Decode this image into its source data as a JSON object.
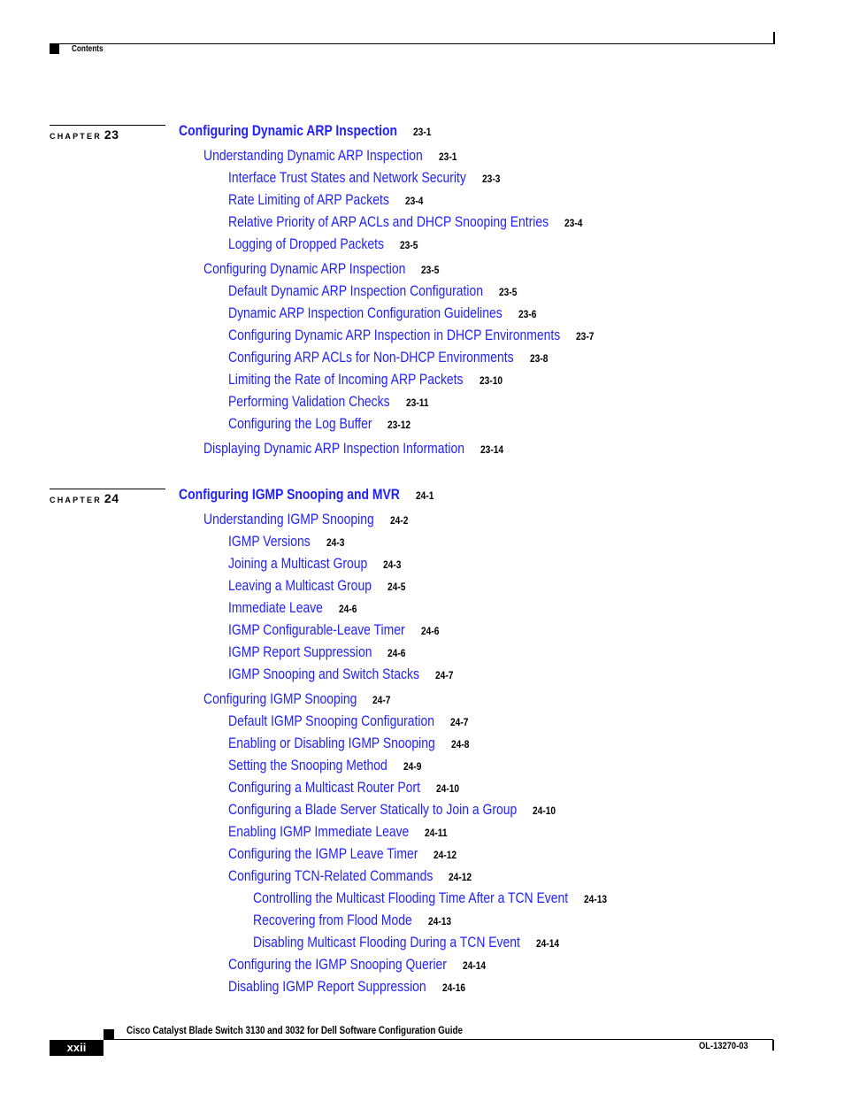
{
  "header": {
    "section_label": "Contents"
  },
  "chapters": [
    {
      "chapter_word": "CHAPTER",
      "number": "23",
      "title": "Configuring Dynamic ARP Inspection",
      "page": "23-1",
      "entries": [
        {
          "level": 1,
          "title": "Understanding Dynamic ARP Inspection",
          "page": "23-1"
        },
        {
          "level": 2,
          "title": "Interface Trust States and Network Security",
          "page": "23-3"
        },
        {
          "level": 2,
          "title": "Rate Limiting of ARP Packets",
          "page": "23-4"
        },
        {
          "level": 2,
          "title": "Relative Priority of ARP ACLs and DHCP Snooping Entries",
          "page": "23-4"
        },
        {
          "level": 2,
          "title": "Logging of Dropped Packets",
          "page": "23-5"
        },
        {
          "level": 1,
          "title": "Configuring Dynamic ARP Inspection",
          "page": "23-5"
        },
        {
          "level": 2,
          "title": "Default Dynamic ARP Inspection Configuration",
          "page": "23-5"
        },
        {
          "level": 2,
          "title": "Dynamic ARP Inspection Configuration Guidelines",
          "page": "23-6"
        },
        {
          "level": 2,
          "title": "Configuring Dynamic ARP Inspection in DHCP Environments",
          "page": "23-7"
        },
        {
          "level": 2,
          "title": "Configuring ARP ACLs for Non-DHCP Environments",
          "page": "23-8"
        },
        {
          "level": 2,
          "title": "Limiting the Rate of Incoming ARP Packets",
          "page": "23-10"
        },
        {
          "level": 2,
          "title": "Performing Validation Checks",
          "page": "23-11"
        },
        {
          "level": 2,
          "title": "Configuring the Log Buffer",
          "page": "23-12"
        },
        {
          "level": 1,
          "title": "Displaying Dynamic ARP Inspection Information",
          "page": "23-14"
        }
      ]
    },
    {
      "chapter_word": "CHAPTER",
      "number": "24",
      "title": "Configuring IGMP Snooping and MVR",
      "page": "24-1",
      "entries": [
        {
          "level": 1,
          "title": "Understanding IGMP Snooping",
          "page": "24-2"
        },
        {
          "level": 2,
          "title": "IGMP Versions",
          "page": "24-3"
        },
        {
          "level": 2,
          "title": "Joining a Multicast Group",
          "page": "24-3"
        },
        {
          "level": 2,
          "title": "Leaving a Multicast Group",
          "page": "24-5"
        },
        {
          "level": 2,
          "title": "Immediate Leave",
          "page": "24-6"
        },
        {
          "level": 2,
          "title": "IGMP Configurable-Leave Timer",
          "page": "24-6"
        },
        {
          "level": 2,
          "title": "IGMP Report Suppression",
          "page": "24-6"
        },
        {
          "level": 2,
          "title": "IGMP Snooping and Switch Stacks",
          "page": "24-7"
        },
        {
          "level": 1,
          "title": "Configuring IGMP Snooping",
          "page": "24-7"
        },
        {
          "level": 2,
          "title": "Default IGMP Snooping Configuration",
          "page": "24-7"
        },
        {
          "level": 2,
          "title": "Enabling or Disabling IGMP Snooping",
          "page": "24-8"
        },
        {
          "level": 2,
          "title": "Setting the Snooping Method",
          "page": "24-9"
        },
        {
          "level": 2,
          "title": "Configuring a Multicast Router Port",
          "page": "24-10"
        },
        {
          "level": 2,
          "title": "Configuring a Blade Server Statically to Join a Group",
          "page": "24-10"
        },
        {
          "level": 2,
          "title": "Enabling IGMP Immediate Leave",
          "page": "24-11"
        },
        {
          "level": 2,
          "title": "Configuring the IGMP Leave Timer",
          "page": "24-12"
        },
        {
          "level": 2,
          "title": "Configuring TCN-Related Commands",
          "page": "24-12"
        },
        {
          "level": 3,
          "title": "Controlling the Multicast Flooding Time After a TCN Event",
          "page": "24-13"
        },
        {
          "level": 3,
          "title": "Recovering from Flood Mode",
          "page": "24-13"
        },
        {
          "level": 3,
          "title": "Disabling Multicast Flooding During a TCN Event",
          "page": "24-14"
        },
        {
          "level": 2,
          "title": "Configuring the IGMP Snooping Querier",
          "page": "24-14"
        },
        {
          "level": 2,
          "title": "Disabling IGMP Report Suppression",
          "page": "24-16"
        }
      ]
    }
  ],
  "footer": {
    "book_title": "Cisco Catalyst Blade Switch 3130 and 3032 for Dell Software Configuration Guide",
    "page_number": "xxii",
    "doc_number": "OL-13270-03"
  },
  "colors": {
    "link": "#1f1fff",
    "text": "#000000"
  }
}
